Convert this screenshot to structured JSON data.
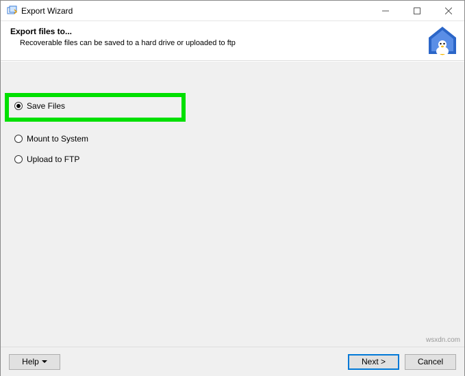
{
  "window": {
    "title": "Export Wizard"
  },
  "header": {
    "title": "Export files to...",
    "subtitle": "Recoverable files can be saved to a hard drive or uploaded to ftp"
  },
  "options": {
    "save_files": "Save Files",
    "mount_to_system": "Mount to System",
    "upload_to_ftp": "Upload to FTP",
    "selected": "save_files"
  },
  "buttons": {
    "help": "Help",
    "next": "Next >",
    "cancel": "Cancel"
  },
  "watermark": "wsxdn.com"
}
